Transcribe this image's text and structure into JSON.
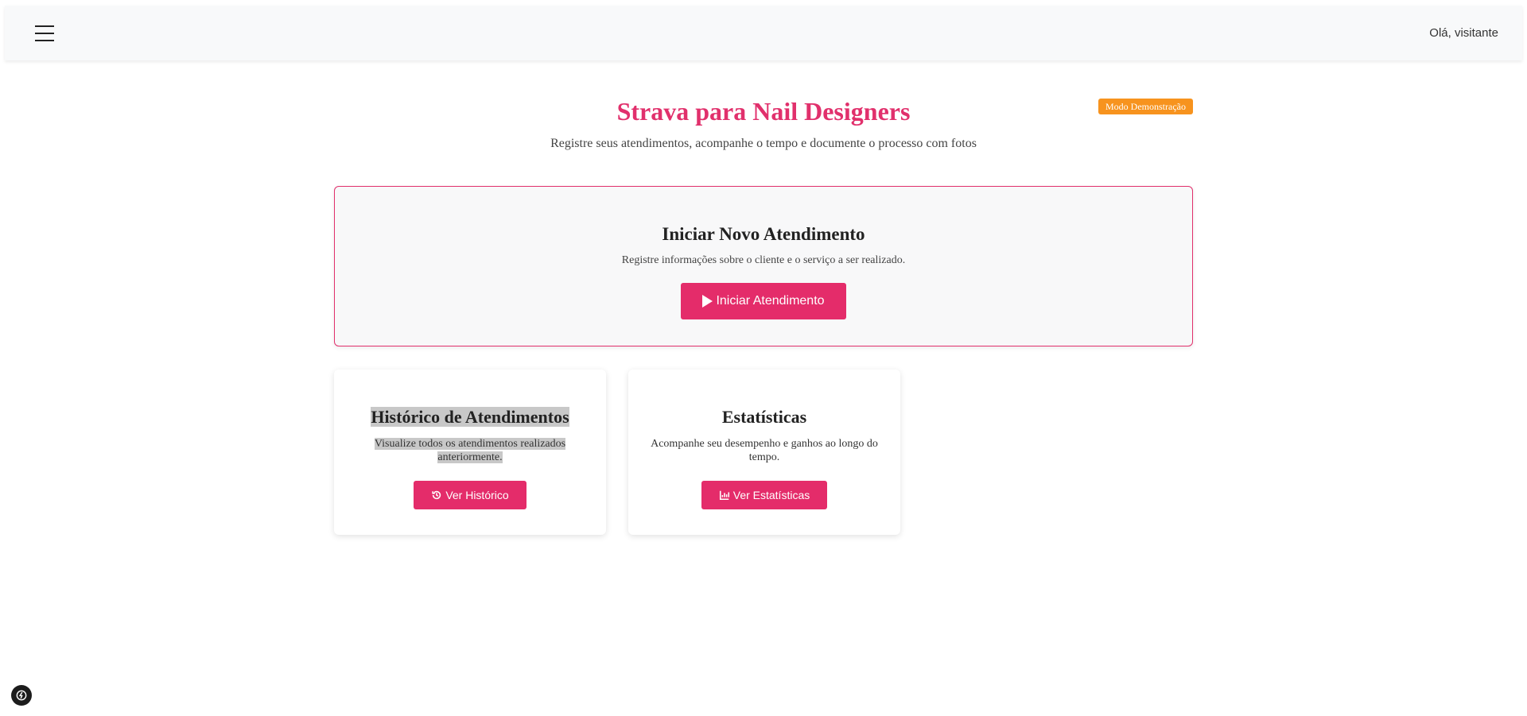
{
  "header": {
    "menu_icon": "hamburger-menu-icon",
    "greeting": "Olá, visitante"
  },
  "page": {
    "title": "Strava para Nail Designers",
    "badge": "Modo Demonstração",
    "subtitle": "Registre seus atendimentos, acompanhe o tempo e documente o processo com fotos"
  },
  "hero": {
    "title": "Iniciar Novo Atendimento",
    "description": "Registre informações sobre o cliente e o serviço a ser realizado.",
    "button_label": "Iniciar Atendimento",
    "button_icon": "play-icon"
  },
  "cards": [
    {
      "title": "Histórico de Atendimentos",
      "description": "Visualize todos os atendimentos realizados anteriormente.",
      "button_label": "Ver Histórico",
      "button_icon": "history-icon"
    },
    {
      "title": "Estatísticas",
      "description": "Acompanhe seu desempenho e ganhos ao longo do tempo.",
      "button_label": "Ver Estatísticas",
      "button_icon": "bar-chart-icon"
    }
  ],
  "colors": {
    "brand": "#e1306c",
    "badge": "#f7931e",
    "topbar": "#f8f9fa"
  }
}
